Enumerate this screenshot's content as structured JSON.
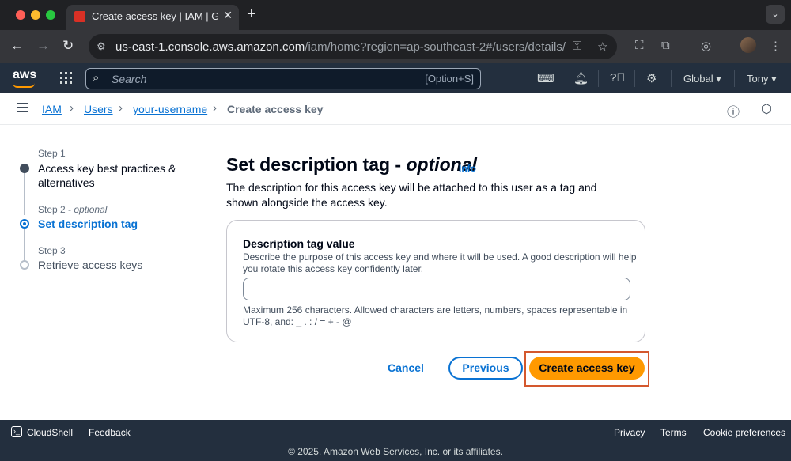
{
  "browser": {
    "tab_title": "Create access key | IAM | Global",
    "url_host": "us-east-1.console.aws.amazon.com",
    "url_path": "/iam/home?region=ap-southeast-2#/users/details/your-username/create-access-key"
  },
  "aws": {
    "logo": "aws",
    "search_placeholder": "Search",
    "search_shortcut": "[Option+S]",
    "region": "Global",
    "account": "Tony"
  },
  "breadcrumb": {
    "items": [
      "IAM",
      "Users",
      "your-username"
    ],
    "current": "Create access key"
  },
  "steps": [
    {
      "label": "Step 1",
      "title": "Access key best practices & alternatives"
    },
    {
      "label": "Step 2",
      "label_optional": "optional",
      "title": "Set description tag"
    },
    {
      "label": "Step 3",
      "title": "Retrieve access keys"
    }
  ],
  "main": {
    "heading": "Set description tag -",
    "heading_optional": "optional",
    "info": "Info",
    "description": "The description for this access key will be attached to this user as a tag and shown alongside the access key.",
    "field_label": "Description tag value",
    "field_description": "Describe the purpose of this access key and where it will be used. A good description will help you rotate this access key confidently later.",
    "field_value": "",
    "field_hint": "Maximum 256 characters. Allowed characters are letters, numbers, spaces representable in UTF-8, and: _ . : / = + - @"
  },
  "actions": {
    "cancel": "Cancel",
    "previous": "Previous",
    "create": "Create access key"
  },
  "footer": {
    "cloudshell": "CloudShell",
    "feedback": "Feedback",
    "privacy": "Privacy",
    "terms": "Terms",
    "cookies": "Cookie preferences",
    "copyright": "© 2025, Amazon Web Services, Inc. or its affiliates."
  },
  "colors": {
    "primary_button": "#ff9900",
    "link": "#0972d3",
    "header_bg": "#232f3e",
    "highlight_frame": "#d4582e"
  }
}
